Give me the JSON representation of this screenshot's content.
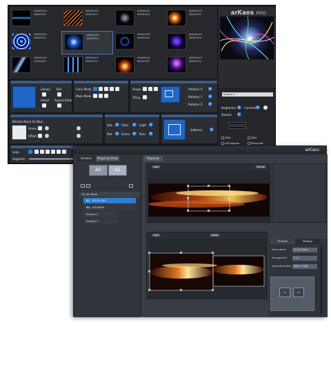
{
  "back_window": {
    "logo": "arKaos",
    "logo_suffix": "PRO",
    "clips": [
      {
        "thumb": "blue-streak",
        "lines": [
          "00000Fx0'0",
          "00000'00'0"
        ]
      },
      {
        "thumb": "orange-diagonal",
        "lines": [
          "00000Fx0'0",
          "00000'00'0"
        ]
      },
      {
        "thumb": "dark-glyph",
        "lines": [
          "00000Fx0'0",
          "00000'00'0"
        ]
      },
      {
        "thumb": "orange-spark",
        "lines": [
          "00000Fx0'0",
          "00000'00'0"
        ]
      },
      {
        "thumb": "blue-rings",
        "lines": [
          "00000Fx0'0",
          "00000'00'0"
        ]
      },
      {
        "thumb": "blue-tunnel",
        "lines": [
          "00000Fx0'0",
          "00000'00'0"
        ]
      },
      {
        "thumb": "blue-orb",
        "lines": [
          "00000Fx0'0",
          "00000'00'0"
        ]
      },
      {
        "thumb": "purple-haze",
        "lines": [
          "00000Fx0'0",
          "00000'00'0"
        ]
      },
      {
        "thumb": "blue-lightning",
        "lines": [
          "00000Fx0'0",
          "00000'00'0"
        ]
      },
      {
        "thumb": "blue-bars",
        "lines": [
          "00000Fx0'0",
          "00000'00'0"
        ]
      },
      {
        "thumb": "orange-sweep",
        "lines": [
          "00000Fx0'0",
          "00000'00'0"
        ]
      },
      {
        "thumb": "violet-cloud",
        "lines": [
          "00000Fx0'0",
          "00000'00'0"
        ]
      }
    ],
    "panel1": {
      "library": "Library",
      "text": "Text",
      "visual": "Visual",
      "aspect_ratio": "Aspect Ratio"
    },
    "panel2": {
      "color_mode": "Color Mode",
      "mask_mode": "Mask Mode"
    },
    "panel3": {
      "shape": "Shape",
      "tiling": "Tiling",
      "rotation_x": "Rotation X",
      "rotation_y": "Rotation Y",
      "rotation_z": "Rotation Z"
    },
    "panel4": {
      "title": "Wrinkle Black On Blue",
      "green": "Green",
      "offset": "Offset"
    },
    "panel5": {
      "hue": "Hue",
      "satur": "Satur",
      "light": "Light",
      "red": "Red",
      "green": "Green",
      "blue": "Blue"
    },
    "panel6": {
      "softness": "Softness"
    },
    "transport": {
      "loop": "Loop",
      "segment": "Segment"
    },
    "props": {
      "surface_select": "Surface 1",
      "brightness": "Brightness",
      "contrast": "Contrast",
      "volume": "Volume",
      "options": [
        "DMX",
        "MIDI",
        "LED Mapper",
        "Ethnp Net",
        "Video Mapper",
        "License"
      ]
    }
  },
  "front_window": {
    "logo": "arKaos",
    "tabs": [
      "Screens",
      "Mapping Setup"
    ],
    "screens": [
      "A2",
      "A1"
    ],
    "tree": [
      {
        "type": "group",
        "label": "A1 A2 Setup"
      },
      {
        "type": "screen",
        "id": "A1",
        "label": "1920X1080"
      },
      {
        "type": "screen",
        "id": "A2",
        "label": "1024X600"
      },
      {
        "type": "surface",
        "label": "Surface 1"
      },
      {
        "type": "surface",
        "label": "Surface 2"
      }
    ],
    "main_tab": "Mapping",
    "top_pane": {
      "button_left": "Next",
      "button_right": "Sink All"
    },
    "bottom_pane": {
      "button_left": "Next",
      "button_mid": "Global"
    },
    "inspector": {
      "tabs": [
        "Surface",
        "Display"
      ],
      "rows": [
        {
          "key": "Group Name",
          "value": "A1 A2 Setup"
        },
        {
          "key": "Arrangement",
          "value": "2 x 1"
        },
        {
          "key": "Group Resolution",
          "value": "3840 x 1080"
        }
      ],
      "mini_screens": [
        "A1",
        "A2"
      ]
    }
  },
  "colors": {
    "accent": "#2d7fd0",
    "panel_bar": "#3d5b86"
  }
}
